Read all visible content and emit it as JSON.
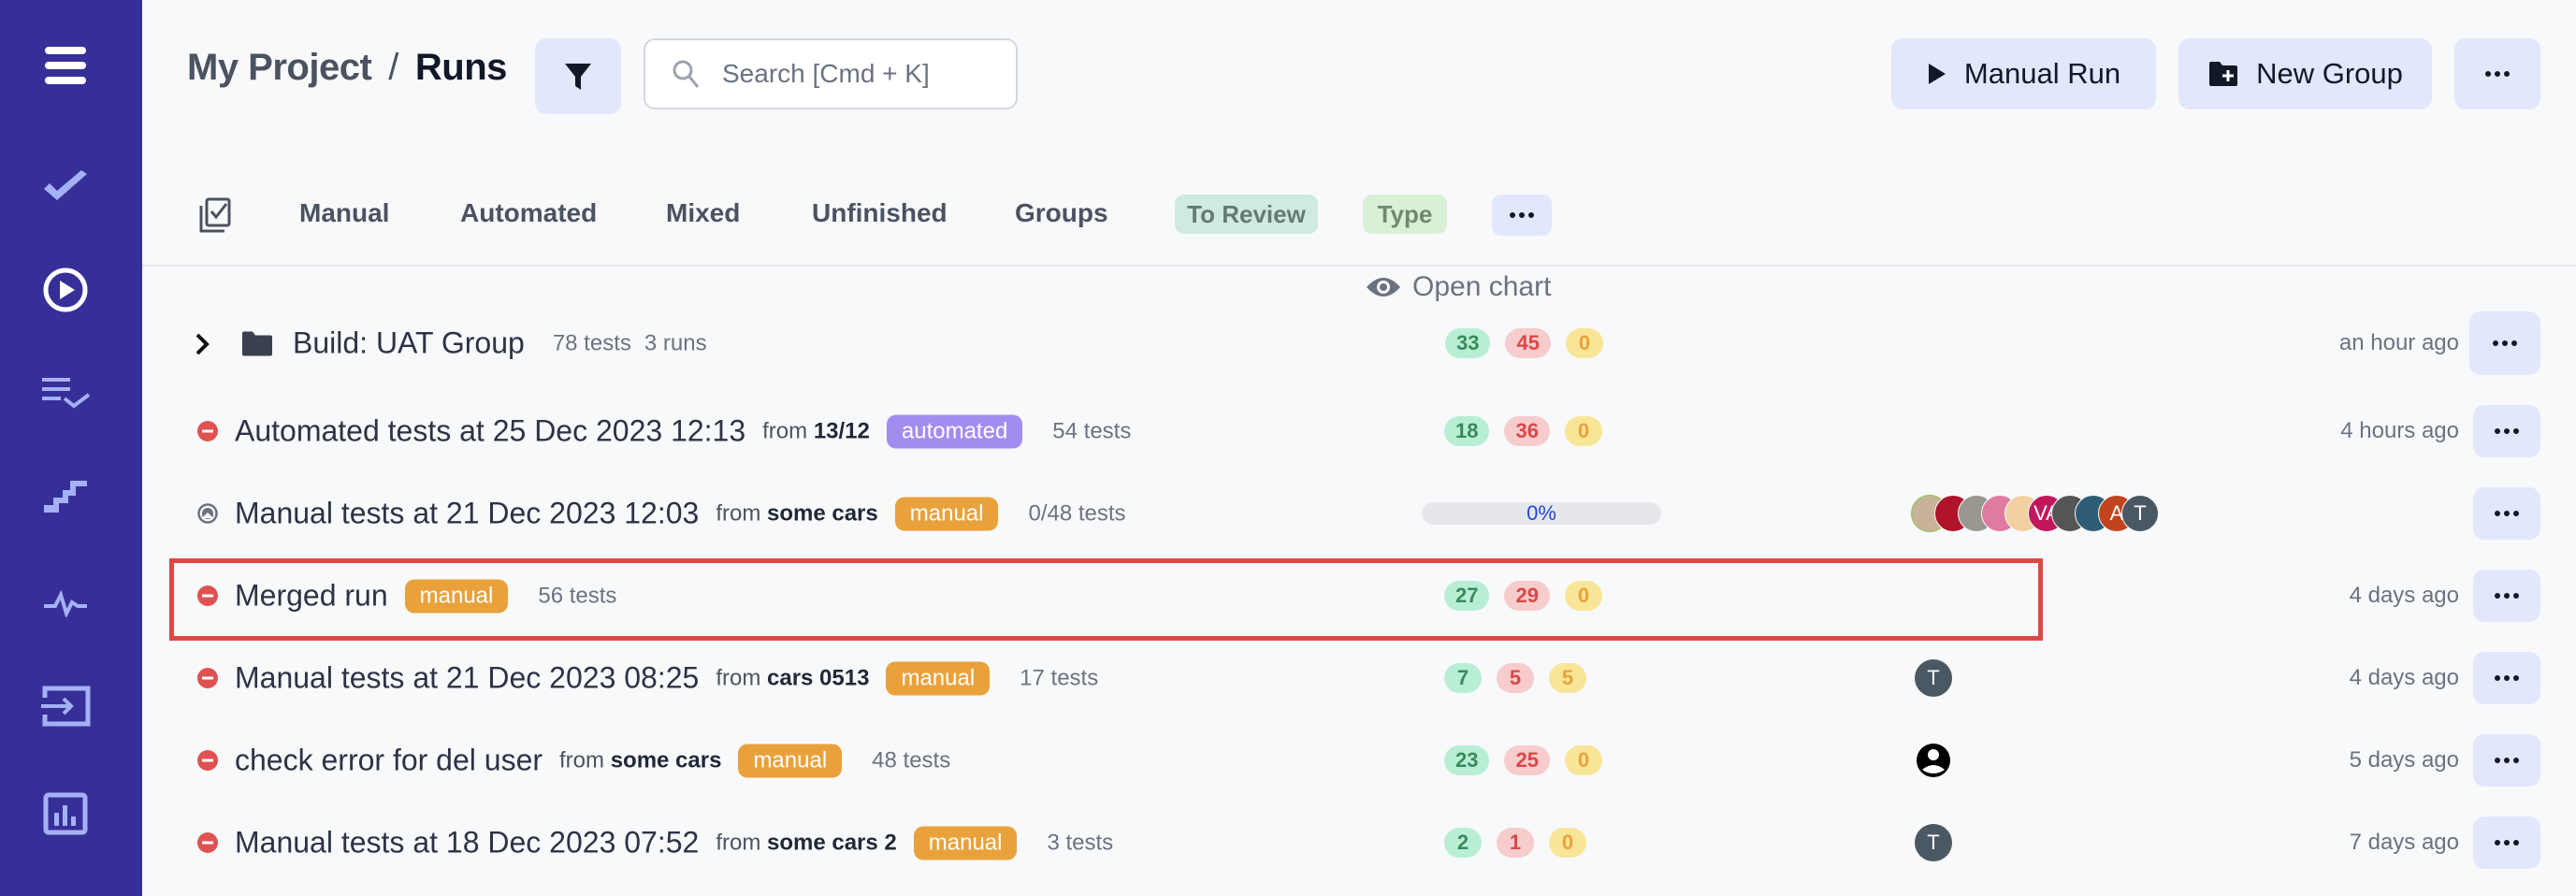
{
  "breadcrumb": {
    "project": "My Project",
    "separator": "/",
    "current": "Runs"
  },
  "search": {
    "placeholder": "Search [Cmd + K]",
    "value": ""
  },
  "header_buttons": {
    "manual_run": "Manual Run",
    "new_group": "New Group"
  },
  "sidebar": {
    "items": [
      {
        "icon": "menu-icon"
      },
      {
        "icon": "check-icon"
      },
      {
        "icon": "play-circle-icon"
      },
      {
        "icon": "list-check-icon"
      },
      {
        "icon": "steps-icon"
      },
      {
        "icon": "pulse-icon"
      },
      {
        "icon": "import-icon"
      },
      {
        "icon": "analytics-icon"
      }
    ]
  },
  "tabs": {
    "items": [
      "Manual",
      "Automated",
      "Mixed",
      "Unfinished",
      "Groups"
    ],
    "to_review": "To Review",
    "type": "Type"
  },
  "open_chart": "Open chart",
  "rows": [
    {
      "kind": "group",
      "title": "Build: UAT Group",
      "tests": "78 tests",
      "runs": "3 runs",
      "passed": "33",
      "failed": "45",
      "skipped": "0",
      "time": "an hour ago"
    },
    {
      "kind": "run",
      "status": "failed",
      "title": "Automated tests at 25 Dec 2023 12:13",
      "from_label": "from",
      "from": "13/12",
      "tag": "automated",
      "tests": "54 tests",
      "passed": "18",
      "failed": "36",
      "skipped": "0",
      "time": "4 hours ago"
    },
    {
      "kind": "run",
      "status": "in-progress",
      "title": "Manual tests at 21 Dec 2023 12:03",
      "from_label": "from",
      "from": "some cars",
      "tag": "manual",
      "tests": "0/48 tests",
      "progress": "0%",
      "progress_value": 0,
      "avatars": [
        "",
        "",
        "",
        "",
        "",
        "VA",
        "",
        "",
        "A",
        "T"
      ],
      "time": ""
    },
    {
      "kind": "run",
      "status": "failed",
      "title": "Merged run",
      "tag": "manual",
      "tests": "56 tests",
      "passed": "27",
      "failed": "29",
      "skipped": "0",
      "time": "4 days ago",
      "highlighted": true
    },
    {
      "kind": "run",
      "status": "failed",
      "title": "Manual tests at 21 Dec 2023 08:25",
      "from_label": "from",
      "from": "cars 0513",
      "tag": "manual",
      "tests": "17 tests",
      "passed": "7",
      "failed": "5",
      "skipped": "5",
      "assignee": "T",
      "time": "4 days ago"
    },
    {
      "kind": "run",
      "status": "failed",
      "title": "check error for del user",
      "from_label": "from",
      "from": "some cars",
      "tag": "manual",
      "tests": "48 tests",
      "passed": "23",
      "failed": "25",
      "skipped": "0",
      "assignee": "user-icon",
      "time": "5 days ago"
    },
    {
      "kind": "run",
      "status": "failed",
      "title": "Manual tests at 18 Dec 2023 07:52",
      "from_label": "from",
      "from": "some cars 2",
      "tag": "manual",
      "tests": "3 tests",
      "passed": "2",
      "failed": "1",
      "skipped": "0",
      "assignee": "T",
      "time": "7 days ago"
    }
  ],
  "colors": {
    "sidebar": "#372f98",
    "accent_button": "#e2e7fc",
    "passed": "#3a8a5e",
    "failed": "#d94848",
    "skipped": "#e8a33a",
    "tag_manual": "#e9a23b",
    "tag_automated": "#a38cf0",
    "highlight": "#e04848"
  }
}
